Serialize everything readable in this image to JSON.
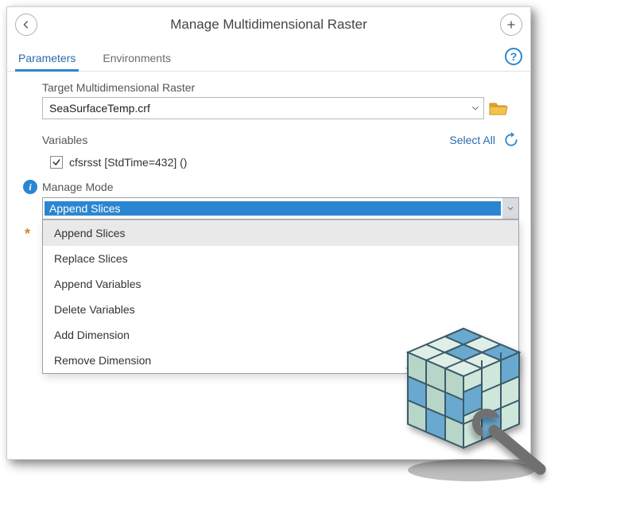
{
  "header": {
    "title": "Manage Multidimensional Raster"
  },
  "tabs": {
    "items": [
      {
        "label": "Parameters",
        "active": true
      },
      {
        "label": "Environments",
        "active": false
      }
    ]
  },
  "target": {
    "label": "Target Multidimensional Raster",
    "value": "SeaSurfaceTemp.crf"
  },
  "variables": {
    "label": "Variables",
    "select_all": "Select All",
    "items": [
      {
        "checked": true,
        "text": "cfsrsst [StdTime=432] ()"
      }
    ]
  },
  "manage_mode": {
    "label": "Manage Mode",
    "selected": "Append Slices",
    "options": [
      "Append Slices",
      "Replace Slices",
      "Append Variables",
      "Delete Variables",
      "Add Dimension",
      "Remove Dimension"
    ]
  }
}
